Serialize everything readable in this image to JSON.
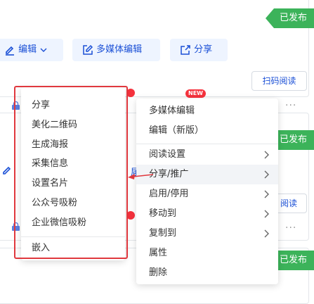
{
  "card1": {
    "status": "已发布",
    "edit_label": "编辑",
    "multimedia_edit_label": "多媒体编辑",
    "share_label": "分享",
    "scan_read_label": "扫码阅读",
    "more": "···"
  },
  "card2": {
    "status": "已发布",
    "scan_read_label": "阅读",
    "more": "···",
    "partial_text": "届"
  },
  "card3": {
    "status": "已发布"
  },
  "new_badge": "NEW",
  "main_menu": {
    "items": [
      {
        "label": "多媒体编辑"
      },
      {
        "label": "编辑（新版）"
      },
      {
        "label": "阅读设置"
      },
      {
        "label": "分享/推广"
      },
      {
        "label": "启用/停用"
      },
      {
        "label": "移动到"
      },
      {
        "label": "复制到"
      },
      {
        "label": "属性"
      },
      {
        "label": "删除"
      }
    ]
  },
  "submenu": {
    "items": [
      {
        "label": "分享"
      },
      {
        "label": "美化二维码"
      },
      {
        "label": "生成海报"
      },
      {
        "label": "采集信息"
      },
      {
        "label": "设置名片"
      },
      {
        "label": "公众号吸粉"
      },
      {
        "label": "企业微信吸粉"
      },
      {
        "label": "嵌入"
      }
    ]
  },
  "colors": {
    "accent": "#1a4fd6",
    "published": "#3cb35a",
    "annotation": "#e0383e"
  }
}
